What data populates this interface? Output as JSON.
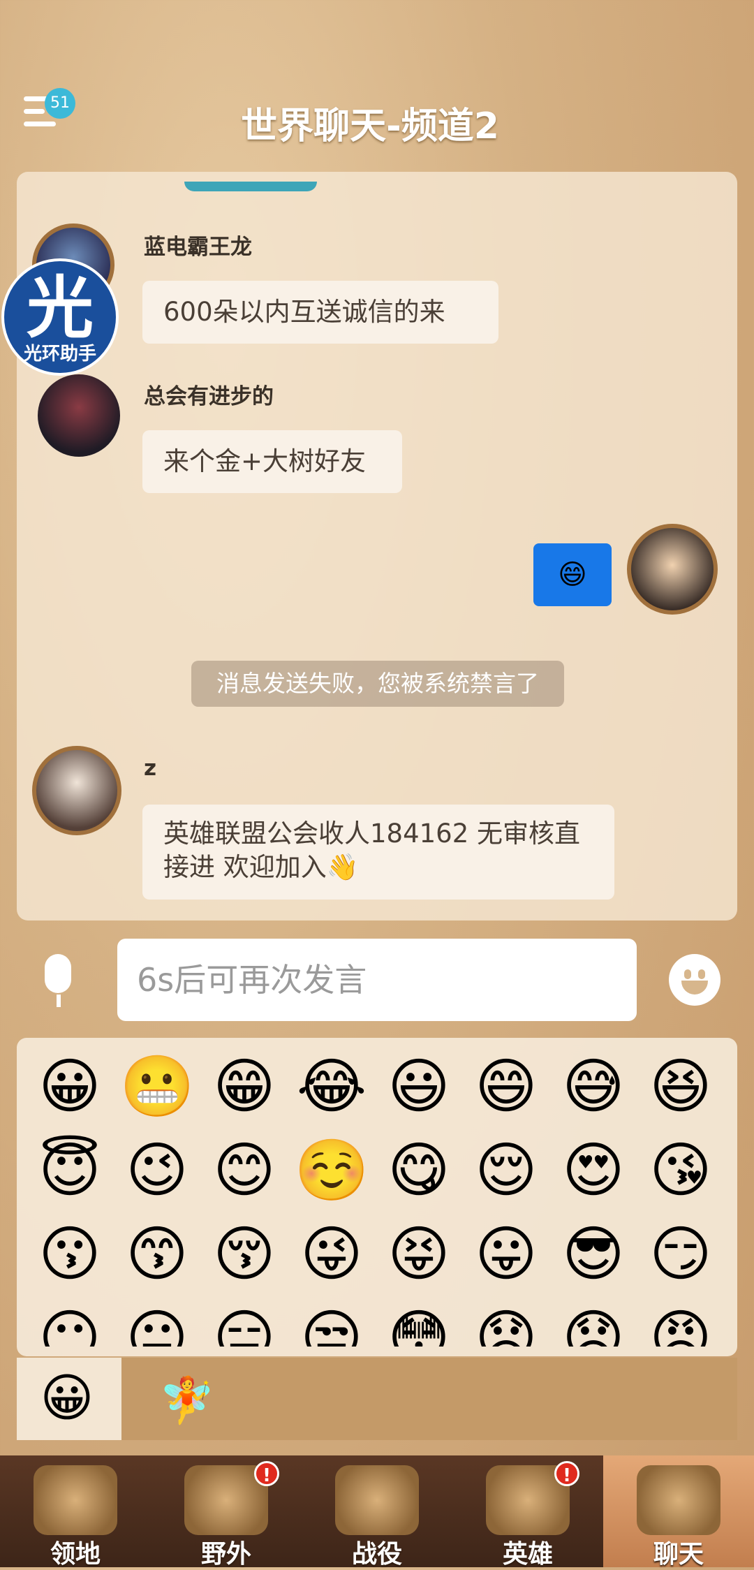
{
  "header": {
    "title": "世界聊天-频道2",
    "unread_badge": "51"
  },
  "helper_overlay": {
    "char": "光",
    "label": "光环助手"
  },
  "messages": [
    {
      "username": "蓝电霸王龙",
      "text": "600朵以内互送诚信的来"
    },
    {
      "username": "总会有进步的",
      "text": "来个金+大树好友"
    },
    {
      "self": true,
      "text": "😄"
    },
    {
      "system": true,
      "text": "消息发送失败，您被系统禁言了"
    },
    {
      "username": "z",
      "text": "英雄联盟公会收人184162 无审核直接进 欢迎加入👋"
    }
  ],
  "input": {
    "placeholder": "6s后可再次发言"
  },
  "icons": {
    "menu": "menu-icon",
    "mic": "microphone-icon",
    "emoji_toggle": "smiley-icon"
  },
  "emojis": [
    "😀",
    "😬",
    "😁",
    "😂",
    "😃",
    "😄",
    "😅",
    "😆",
    "😇",
    "😉",
    "😊",
    "☺️",
    "😋",
    "😌",
    "😍",
    "😘",
    "😗",
    "😙",
    "😚",
    "😜",
    "😝",
    "😛",
    "😎",
    "😏",
    "😶",
    "😐",
    "😑",
    "😒",
    "😳",
    "😞",
    "😟",
    "😠"
  ],
  "emoji_tabs": {
    "active": "😀",
    "fairy": "🧚"
  },
  "bottom_nav": [
    {
      "label": "领地",
      "alert": false
    },
    {
      "label": "野外",
      "alert": true
    },
    {
      "label": "战役",
      "alert": false
    },
    {
      "label": "英雄",
      "alert": true
    },
    {
      "label": "聊天",
      "alert": false,
      "active": true
    }
  ],
  "alert_mark": "!",
  "colors": {
    "self_bubble": "#1878e8",
    "badge": "#3cb9d8",
    "alert": "#e02a1e"
  }
}
